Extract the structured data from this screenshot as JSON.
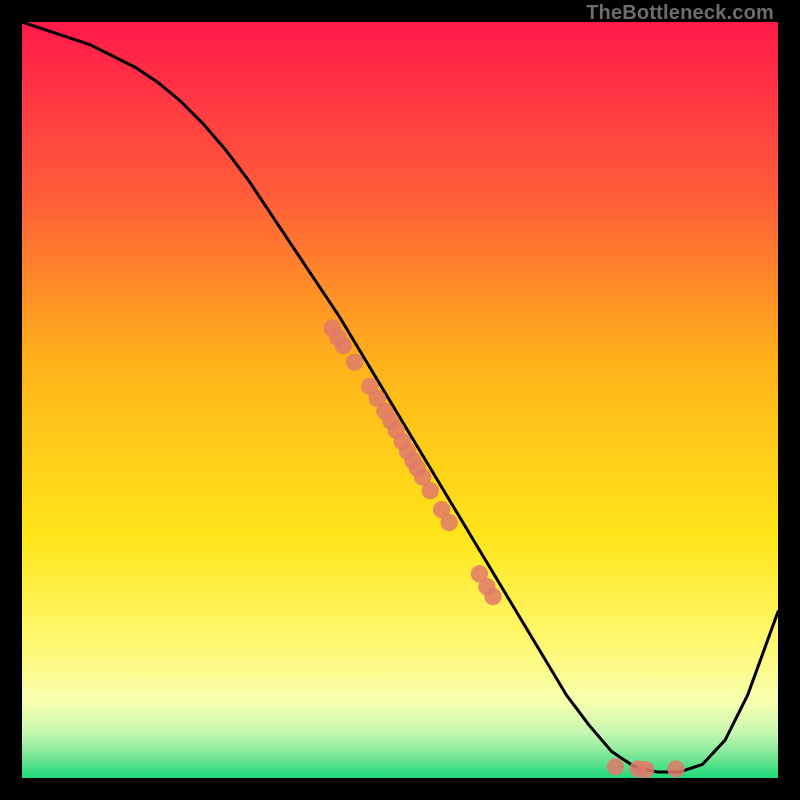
{
  "watermark": "TheBottleneck.com",
  "chart_data": {
    "type": "line",
    "title": "",
    "xlabel": "",
    "ylabel": "",
    "xlim": [
      0,
      100
    ],
    "ylim": [
      0,
      100
    ],
    "grid": false,
    "legend": false,
    "series": [
      {
        "name": "bottleneck-curve",
        "x": [
          0,
          3,
          6,
          9,
          12,
          15,
          18,
          21,
          24,
          27,
          30,
          33,
          36,
          39,
          42,
          45,
          48,
          51,
          54,
          57,
          60,
          63,
          66,
          69,
          72,
          75,
          78,
          81,
          84,
          87,
          90,
          93,
          96,
          100
        ],
        "y": [
          100,
          99,
          98,
          97,
          95.5,
          94,
          92,
          89.5,
          86.5,
          83,
          79,
          74.5,
          70,
          65.5,
          61,
          56,
          51,
          46,
          41,
          36,
          31,
          26,
          21,
          16,
          11,
          7,
          3.5,
          1.5,
          0.8,
          0.8,
          1.8,
          5,
          11,
          22
        ]
      }
    ],
    "scatter_points": {
      "name": "data-points",
      "color": "#e07a6a",
      "points": [
        {
          "x": 41,
          "y": 59.5
        },
        {
          "x": 41.8,
          "y": 58.2
        },
        {
          "x": 42.5,
          "y": 57.2
        },
        {
          "x": 44,
          "y": 55
        },
        {
          "x": 46,
          "y": 51.8
        },
        {
          "x": 47,
          "y": 50.2
        },
        {
          "x": 48,
          "y": 48.5
        },
        {
          "x": 48.8,
          "y": 47.2
        },
        {
          "x": 49.5,
          "y": 46
        },
        {
          "x": 50.3,
          "y": 44.5
        },
        {
          "x": 51,
          "y": 43.2
        },
        {
          "x": 51.7,
          "y": 42
        },
        {
          "x": 52.3,
          "y": 41
        },
        {
          "x": 53,
          "y": 39.8
        },
        {
          "x": 54,
          "y": 38
        },
        {
          "x": 55.5,
          "y": 35.5
        },
        {
          "x": 56.5,
          "y": 33.8
        },
        {
          "x": 60.5,
          "y": 27
        },
        {
          "x": 61.5,
          "y": 25.3
        },
        {
          "x": 62.3,
          "y": 24
        },
        {
          "x": 78.5,
          "y": 1.5
        },
        {
          "x": 81.5,
          "y": 1.2
        },
        {
          "x": 82.5,
          "y": 1.1
        },
        {
          "x": 86.5,
          "y": 1.2
        }
      ]
    },
    "background_gradient": {
      "stops": [
        {
          "y": 100,
          "color": "#ff1a4a"
        },
        {
          "y": 78,
          "color": "#ff5a3a"
        },
        {
          "y": 55,
          "color": "#ffb31a"
        },
        {
          "y": 32,
          "color": "#ffe61a"
        },
        {
          "y": 18,
          "color": "#fff870"
        },
        {
          "y": 10,
          "color": "#f7ffb0"
        },
        {
          "y": 6,
          "color": "#c7f7b0"
        },
        {
          "y": 3,
          "color": "#7de898"
        },
        {
          "y": 0,
          "color": "#1fd87a"
        }
      ]
    }
  }
}
